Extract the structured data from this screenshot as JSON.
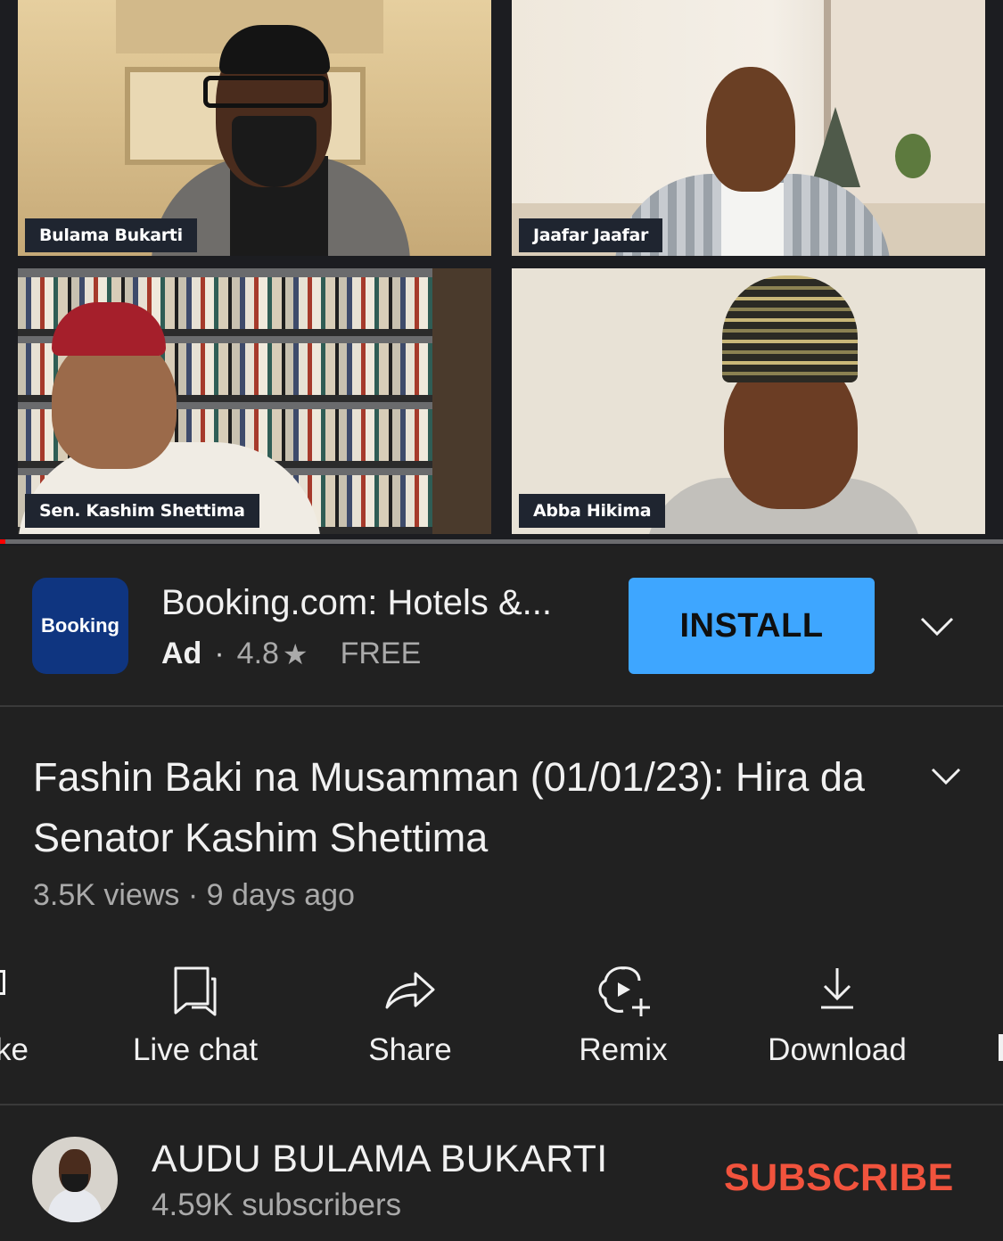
{
  "video": {
    "participants": [
      {
        "name": "Bulama Bukarti"
      },
      {
        "name": "Jaafar Jaafar"
      },
      {
        "name": "Sen. Kashim Shettima"
      },
      {
        "name": "Abba Hikima"
      }
    ],
    "progress_fraction": 0.005,
    "progress_color": "#ff0000"
  },
  "ad": {
    "logo_text": "Booking",
    "logo_bg": "#0f3580",
    "title": "Booking.com: Hotels &...",
    "label": "Ad",
    "separator": "·",
    "rating": "4.8",
    "star_icon": "star-icon",
    "price": "FREE",
    "install_label": "INSTALL",
    "install_color": "#3ea6ff",
    "expand_icon": "chevron-down-icon"
  },
  "video_info": {
    "title": "Fashin Baki na Musamman (01/01/23): Hira da Senator Kashim Shettima",
    "stats": "3.5K views · 9 days ago",
    "expand_icon": "chevron-down-icon"
  },
  "actions": {
    "partial_left_label": "ke",
    "items": [
      {
        "label": "Live chat",
        "icon": "live-chat-icon"
      },
      {
        "label": "Share",
        "icon": "share-icon"
      },
      {
        "label": "Remix",
        "icon": "remix-icon"
      },
      {
        "label": "Download",
        "icon": "download-icon"
      }
    ]
  },
  "channel": {
    "name": "AUDU BULAMA BUKARTI",
    "subscribers": "4.59K subscribers",
    "subscribe_label": "SUBSCRIBE",
    "subscribe_color": "#f1533d"
  }
}
